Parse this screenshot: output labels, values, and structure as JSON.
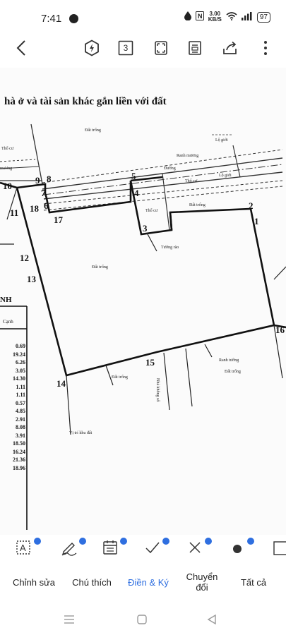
{
  "status_bar": {
    "time": "7:41",
    "speed_top": "3.00",
    "speed_bottom": "KB/S",
    "battery": "97"
  },
  "toolbar": {
    "page_count": "3"
  },
  "document": {
    "title": "hà ở và tài sản khác gắn liền với đất",
    "point_labels": [
      "10",
      "9",
      "8",
      "7",
      "5",
      "4",
      "2",
      "1",
      "11",
      "18",
      "6",
      "17",
      "3",
      "12",
      "13",
      "14",
      "15",
      "16"
    ],
    "map_labels": {
      "dat_trong_top": "Đất trống",
      "lo_gioi_1": "Lộ giới",
      "lo_gioi_2": "Lộ giới",
      "tho_cu_left": "Thổ cư",
      "mang": "mương",
      "ranh_mang": "Ranh mương",
      "duong": "Đường",
      "tho_cu_mid": "Thổ cư",
      "tho_cu_small": "Thổ cư",
      "dat_trong_right": "Đất trống",
      "tuong_rao": "Tường rào",
      "dat_trong_center": "Đất trống",
      "ranh_tuong": "Ranh tường",
      "dat_trong_bottom": "Đất trống",
      "dat_trong_bl": "Đất trống",
      "vi_tri": "Vị trí khu đất",
      "nha": "Nhà không số"
    },
    "table": {
      "header_fragment": "NH",
      "column": "Cạnh",
      "values": [
        "0.69",
        "19.24",
        "6.26",
        "3.05",
        "14.30",
        "1.11",
        "1.11",
        "0.57",
        "4.85",
        "2.91",
        "8.08",
        "3.91",
        "18.50",
        "16.24",
        "21.36",
        "18.96"
      ]
    }
  },
  "edit_tools": [
    "text-box",
    "signature",
    "form",
    "check",
    "cross",
    "dot"
  ],
  "tabs": [
    {
      "label": "Chỉnh sửa",
      "active": false
    },
    {
      "label": "Chú thích",
      "active": false
    },
    {
      "label": "Điền & Ký",
      "active": true
    },
    {
      "label": "Chuyển đổi",
      "active": false
    },
    {
      "label": "Tất cả",
      "active": false
    }
  ],
  "colors": {
    "accent": "#2f6fe0",
    "ink": "#111111"
  }
}
